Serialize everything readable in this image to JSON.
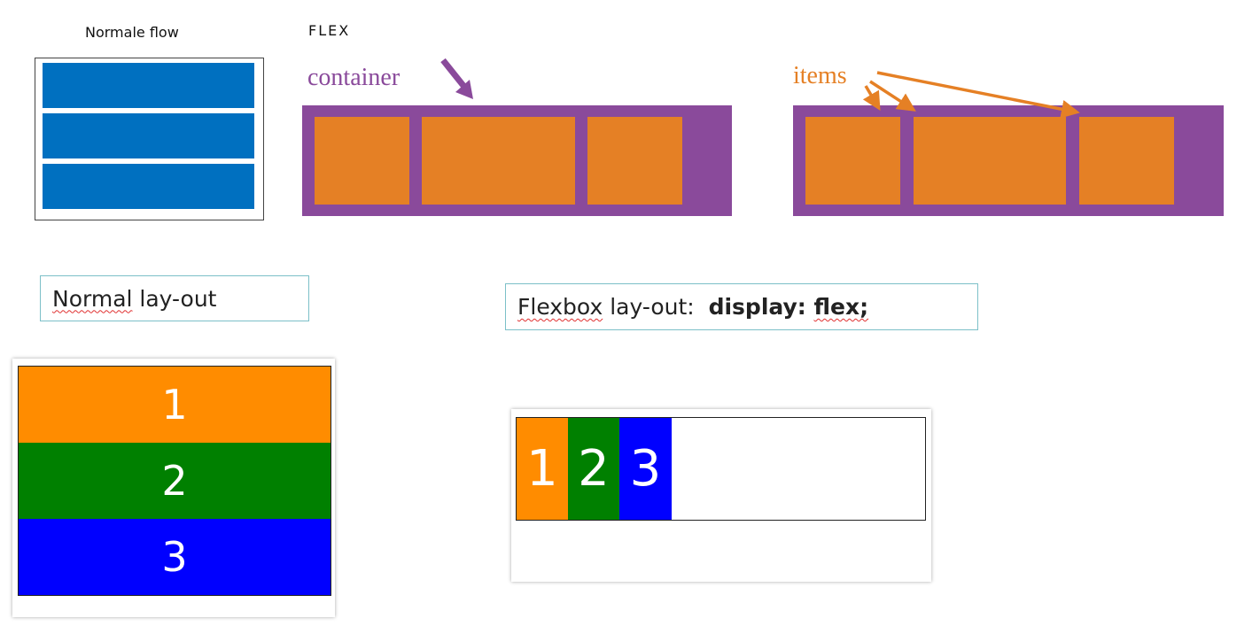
{
  "labels": {
    "normal_flow": "Normale flow",
    "flex": "FLEX",
    "container": "container",
    "items": "items"
  },
  "captions": {
    "normal_word": "Normal",
    "normal_rest": " lay-out",
    "flexbox_word": "Flexbox",
    "flexbox_rest": " lay-out:  ",
    "display_prop": "display: ",
    "flex_value": "flex;"
  },
  "demo": {
    "items": [
      "1",
      "2",
      "3"
    ]
  },
  "colors": {
    "blue_bar": "#0070c0",
    "purple": "#8a4a9b",
    "orange_item": "#e58025",
    "demo_orange": "#ff8c00",
    "demo_green": "#008000",
    "demo_blue": "#0000ff"
  }
}
